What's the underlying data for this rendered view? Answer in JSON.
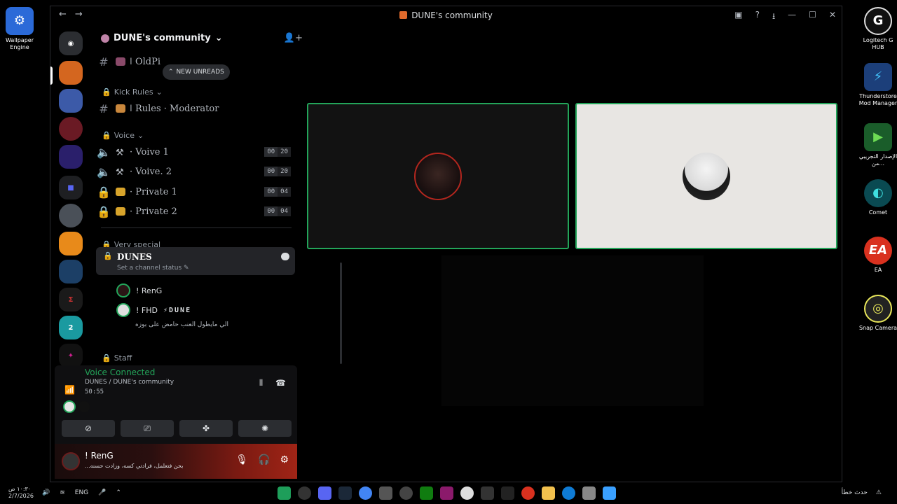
{
  "window": {
    "title": "DUNE's community"
  },
  "server": {
    "name": "DUNE's community"
  },
  "unreads_label": "NEW UNREADS",
  "channels": {
    "top_partial": "ǀ OldPi",
    "categories": {
      "kick_rules": "Kick Rules",
      "voice": "Voice",
      "very_special": "Very special",
      "staff": "Staff"
    },
    "rules": "ǀ Rules · Moderator",
    "voice_channels": [
      {
        "name": "· Voive 1",
        "count": "00",
        "limit": "20"
      },
      {
        "name": "· Voive. 2",
        "count": "00",
        "limit": "20"
      },
      {
        "name": "· Private 1",
        "count": "00",
        "limit": "04"
      },
      {
        "name": "· Private 2",
        "count": "00",
        "limit": "04"
      }
    ],
    "active": {
      "name": "DUNES",
      "status": "Set a channel status"
    },
    "voice_users": [
      {
        "name": "! RenG",
        "tag": ""
      },
      {
        "name": "! FHD",
        "tag": "⚡DUNE"
      }
    ],
    "voice_status_text": "الي مايطول العنب حامض على بوزه"
  },
  "voice_panel": {
    "connected": "Voice Connected",
    "location": "DUNES / DUNE's community",
    "time": "50:55"
  },
  "user_panel": {
    "name": "! RenG",
    "status": "بحن فتعلمل، فرادتي كسه، وزادت حسنه..."
  },
  "desktop_icons": [
    {
      "label": "Wallpaper Engine",
      "color": "#2b6ad8",
      "glyph": "⚙"
    },
    {
      "label": "Logitech G HUB",
      "color": "#111111",
      "glyph": "G"
    },
    {
      "label": "Thunderstore Mod Manager",
      "color": "#1c3f7a",
      "glyph": "⚡"
    },
    {
      "label": "الإصدار التجريبي من...",
      "color": "#1a5d2a",
      "glyph": "▶"
    },
    {
      "label": "Comet",
      "color": "#0a4a52",
      "glyph": "◐"
    },
    {
      "label": "EA",
      "color": "#d9311f",
      "glyph": "EA"
    },
    {
      "label": "Snap Camera",
      "color": "#222222",
      "glyph": "◎"
    }
  ],
  "taskbar": {
    "clock_time": "١٠:٣٠ ص",
    "clock_date": "2/7/2026",
    "lang": "ENG",
    "notice": "حدث خطأ"
  },
  "colors": {
    "accent_green": "#23a55a",
    "tile_bg_dark": "#121212",
    "tile_bg_light": "#e8e6e3"
  }
}
